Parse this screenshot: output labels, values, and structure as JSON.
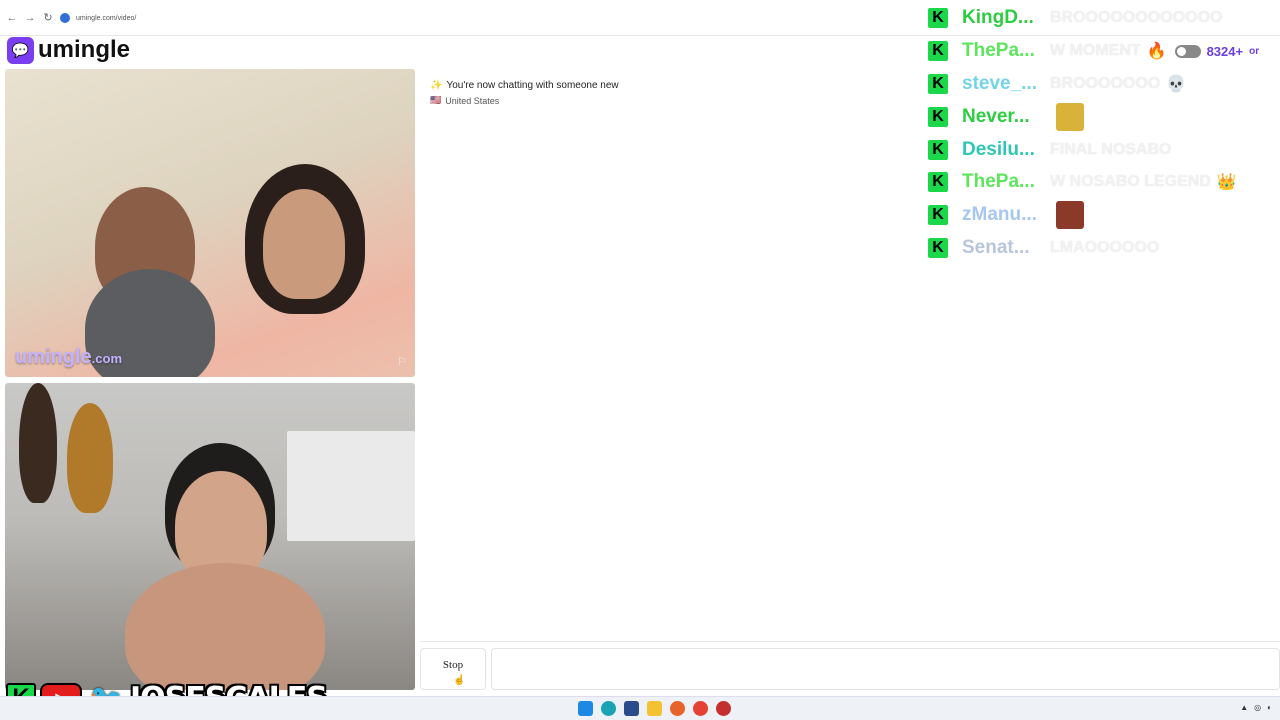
{
  "browser": {
    "url": "umingle.com/video/"
  },
  "brand": {
    "logo_glyph": "💬",
    "name": "umingle"
  },
  "remote_video": {
    "watermark_main": "umingle",
    "watermark_suffix": ".com",
    "flag_glyph": "⚐"
  },
  "chat": {
    "status_icon": "✨",
    "status_text": "You're now chatting with someone new",
    "country_flag": "🇺🇸",
    "country": "United States"
  },
  "controls": {
    "stop_label": "Stop",
    "cursor_glyph": "☝"
  },
  "stream_chat": {
    "badge_letter": "K",
    "viewers": "8324+",
    "viewers_suffix": "or",
    "lines": [
      {
        "user": "KingD...",
        "color": "#2ecc40",
        "message": "BROOOOOOOOOOOO",
        "emoji": ""
      },
      {
        "user": "ThePa...",
        "color": "#5ee55e",
        "message": "W MOMENT",
        "emoji": "🔥"
      },
      {
        "user": "steve_...",
        "color": "#74d3e6",
        "message": "BROOOOOOO",
        "emoji": "💀"
      },
      {
        "user": "Never...",
        "color": "#2ecc40",
        "message": "",
        "emoji": "",
        "emote": "#d9b23a"
      },
      {
        "user": "Desilu...",
        "color": "#2fc7b3",
        "message": "FINAL NOSABO",
        "emoji": ""
      },
      {
        "user": "ThePa...",
        "color": "#5ee55e",
        "message": "W NOSABO LEGEND",
        "emoji": "👑"
      },
      {
        "user": "zManu...",
        "color": "#a6c8f0",
        "message": "",
        "emoji": "",
        "emote": "#8b3a2a"
      },
      {
        "user": "Senat...",
        "color": "#b8c6dc",
        "message": "LMAOOOOOO",
        "emoji": ""
      }
    ]
  },
  "socials": {
    "kick_letter": "K",
    "youtube_glyph": "▶",
    "twitter_glyph": "🐦",
    "handle": "JOSESCALES"
  }
}
